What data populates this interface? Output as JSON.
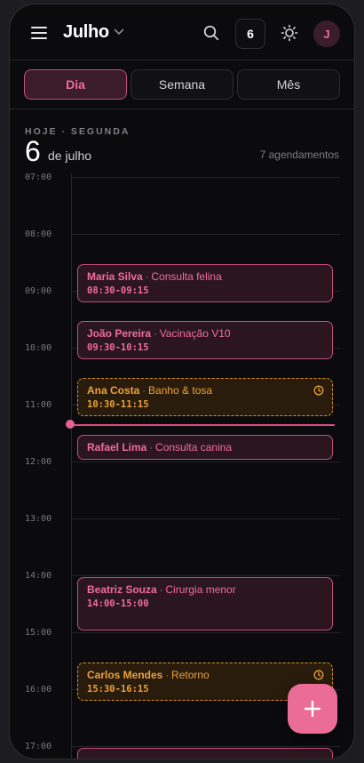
{
  "header": {
    "month_label": "Julho",
    "date_badge": "6",
    "avatar_initial": "J"
  },
  "tabs": [
    {
      "label": "Dia",
      "active": true
    },
    {
      "label": "Semana",
      "active": false
    },
    {
      "label": "Mês",
      "active": false
    }
  ],
  "day_header": {
    "today_label": "HOJE · SEGUNDA",
    "day_number": "6",
    "month_text": "de julho",
    "appointments_count": "7 agendamentos"
  },
  "hours": [
    "07:00",
    "08:00",
    "09:00",
    "10:00",
    "11:00",
    "12:00",
    "13:00",
    "14:00",
    "15:00",
    "16:00",
    "17:00"
  ],
  "now_indicator": {
    "time": "11:15"
  },
  "events": [
    {
      "name": "Maria Silva",
      "service": "Consulta felina",
      "time": "08:30-09:15",
      "style": "pink",
      "pending": false
    },
    {
      "name": "João Pereira",
      "service": "Vacinação V10",
      "time": "09:30-10:15",
      "style": "pink",
      "pending": false
    },
    {
      "name": "Ana Costa",
      "service": "Banho & tosa",
      "time": "10:30-11:15",
      "style": "orange",
      "pending": true
    },
    {
      "name": "Rafael Lima",
      "service": "Consulta canina",
      "time": "",
      "style": "pink",
      "pending": false
    },
    {
      "name": "Beatriz Souza",
      "service": "Cirurgia menor",
      "time": "14:00-15:00",
      "style": "pink",
      "pending": false
    },
    {
      "name": "Carlos Mendes",
      "service": "Retorno",
      "time": "15:30-16:15",
      "style": "orange",
      "pending": true
    }
  ],
  "colors": {
    "accent": "#f06d98",
    "accent_bg": "#3a1d28",
    "pending": "#eba238",
    "background": "#0b0b0d"
  },
  "icons": {
    "menu": "menu-icon",
    "chevron": "chevron-down-icon",
    "search": "search-icon",
    "theme": "sun-icon",
    "clock": "clock-icon",
    "add": "plus-icon"
  }
}
